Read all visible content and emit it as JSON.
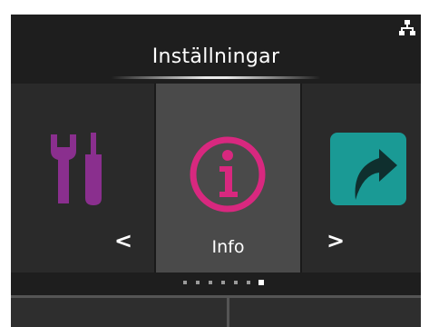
{
  "header": {
    "title": "Inställningar",
    "status_icon": "network-icon"
  },
  "carousel": {
    "items": [
      {
        "name": "settings-tools",
        "icon": "wrench-screwdriver-icon",
        "color": "#8a2f8e"
      },
      {
        "name": "info",
        "label": "Info",
        "icon": "info-icon",
        "color": "#d8287f",
        "selected": true
      },
      {
        "name": "external-link",
        "icon": "arrow-share-icon",
        "color": "#1a9a95"
      }
    ],
    "prev_symbol": "<",
    "next_symbol": ">"
  },
  "pager": {
    "count": 7,
    "active_index": 6
  },
  "colors": {
    "background": "#1e1e1e",
    "selected_panel": "#4a4a4a",
    "tools_purple": "#8a2f8e",
    "info_pink": "#d8287f",
    "link_teal": "#1a9a95"
  }
}
